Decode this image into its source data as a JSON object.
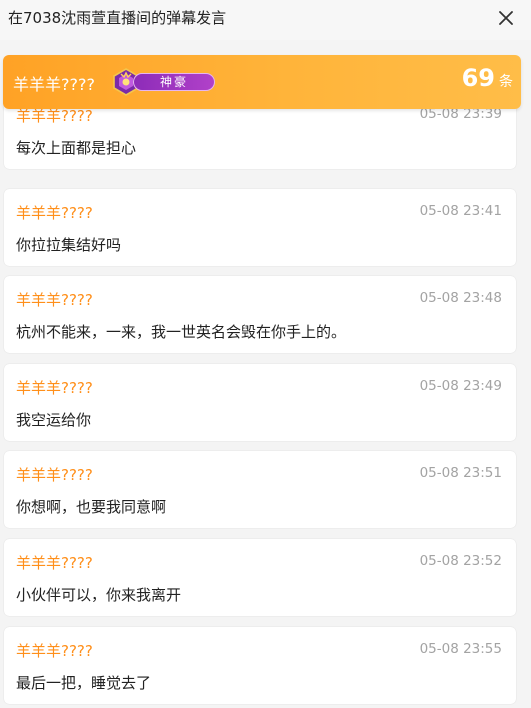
{
  "window": {
    "title": "在7038沈雨萱直播间的弹幕发言",
    "close_icon": "close-icon"
  },
  "header": {
    "user_name": "羊羊羊????",
    "badge_text": "神豪",
    "badge_icon": "crown-emblem-icon",
    "count": "69",
    "count_unit": "条",
    "colors": {
      "bar_start": "#ffa225",
      "bar_end": "#ffbd48",
      "badge": "#8d2cb8"
    }
  },
  "messages": [
    {
      "name": "羊羊羊????",
      "time": "05-08 23:39",
      "text": "每次上面都是担心"
    },
    {
      "name": "羊羊羊????",
      "time": "05-08 23:41",
      "text": "你拉拉集结好吗"
    },
    {
      "name": "羊羊羊????",
      "time": "05-08 23:48",
      "text": "杭州不能来，一来，我一世英名会毁在你手上的。"
    },
    {
      "name": "羊羊羊????",
      "time": "05-08 23:49",
      "text": "我空运给你"
    },
    {
      "name": "羊羊羊????",
      "time": "05-08 23:51",
      "text": "你想啊，也要我同意啊"
    },
    {
      "name": "羊羊羊????",
      "time": "05-08 23:52",
      "text": "小伙伴可以，你来我离开"
    },
    {
      "name": "羊羊羊????",
      "time": "05-08 23:55",
      "text": "最后一把，睡觉去了"
    }
  ],
  "colors": {
    "name": "#ff8f1a",
    "time": "#a3a3a3",
    "text": "#222222"
  }
}
